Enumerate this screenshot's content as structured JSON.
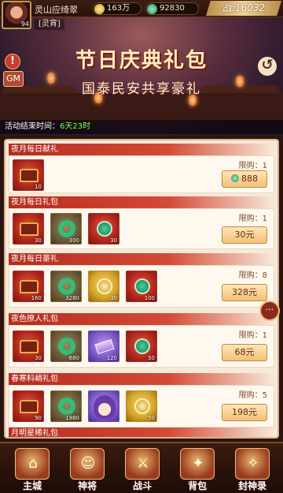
{
  "player": {
    "name": "灵山应绮翠",
    "level": "94",
    "tag": "[灵宵]"
  },
  "currency": {
    "gold": "163万",
    "jade": "92830"
  },
  "power": {
    "label": "战:16032"
  },
  "banner": {
    "title": "节日庆典礼包",
    "subtitle": "国泰民安共享豪礼",
    "gm": "GM",
    "alert": "!",
    "back": "↺"
  },
  "timer": {
    "label": "活动结束时间：",
    "value": "6天23时"
  },
  "sections": [
    {
      "title": "夜月每日献礼",
      "limit": "限购：1",
      "price": "888",
      "price_has_gem": true,
      "items": [
        {
          "icon": "chest-icon",
          "count": "10",
          "color": "red"
        }
      ]
    },
    {
      "title": "夜月每日礼包",
      "limit": "限购：1",
      "price": "30元",
      "items": [
        {
          "icon": "chest-icon",
          "count": "30",
          "color": "red"
        },
        {
          "icon": "jade-ring-icon",
          "count": "300",
          "color": "green"
        },
        {
          "icon": "jade-medal-icon",
          "count": "30",
          "color": "red"
        }
      ]
    },
    {
      "title": "夜月每日豪礼",
      "limit": "限购：8",
      "price": "328元",
      "items": [
        {
          "icon": "chest-icon",
          "count": "160",
          "color": "red"
        },
        {
          "icon": "jade-ring-icon",
          "count": "3280",
          "color": "green"
        },
        {
          "icon": "gold-medal-icon",
          "count": "30",
          "color": "gold"
        },
        {
          "icon": "jade-medal-icon",
          "count": "100",
          "color": "red"
        }
      ]
    },
    {
      "title": "夜色撩人礼包",
      "limit": "限购：1",
      "price": "68元",
      "items": [
        {
          "icon": "chest-icon",
          "count": "30",
          "color": "red"
        },
        {
          "icon": "jade-ring-icon",
          "count": "680",
          "color": "green"
        },
        {
          "icon": "purple-bar-icon",
          "count": "120",
          "color": "purple"
        },
        {
          "icon": "jade-medal-icon",
          "count": "50",
          "color": "red"
        }
      ]
    },
    {
      "title": "春寒料峭礼包",
      "limit": "限购：5",
      "price": "198元",
      "items": [
        {
          "icon": "chest-icon",
          "count": "90",
          "color": "red"
        },
        {
          "icon": "jade-ring-icon",
          "count": "1980",
          "color": "green"
        },
        {
          "icon": "hero-portrait-icon",
          "count": "",
          "color": "purple"
        },
        {
          "icon": "gold-medal-icon",
          "count": "50",
          "color": "gold"
        }
      ]
    },
    {
      "title": "月明星稀礼包",
      "limit": "",
      "price": "",
      "items": []
    }
  ],
  "chat": {
    "label": "···"
  },
  "nav": [
    {
      "label": "主城",
      "glyph": "⌂"
    },
    {
      "label": "神将",
      "glyph": "☺"
    },
    {
      "label": "战斗",
      "glyph": "⚔"
    },
    {
      "label": "背包",
      "glyph": "✦"
    },
    {
      "label": "封神录",
      "glyph": "✧"
    }
  ]
}
